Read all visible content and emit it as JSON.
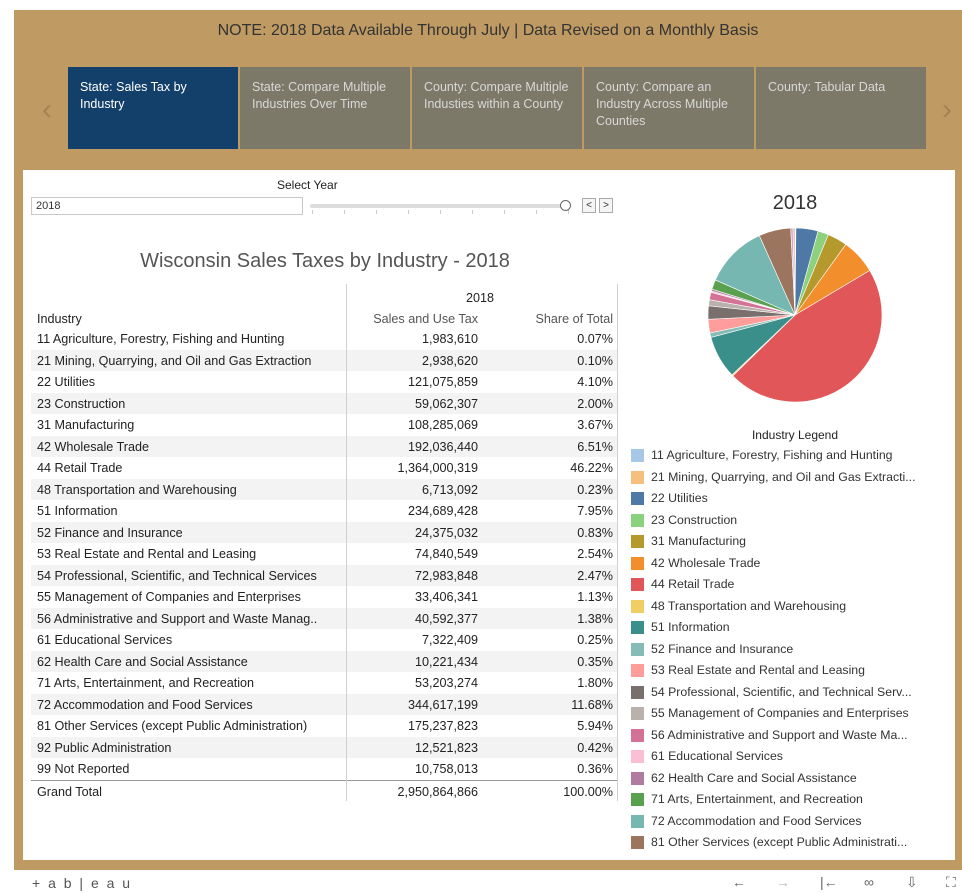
{
  "note": "NOTE: 2018 Data Available Through July | Data Revised on a Monthly Basis",
  "tabs": [
    {
      "label": "State: Sales Tax by Industry"
    },
    {
      "label": "State: Compare Multiple Industries Over Time"
    },
    {
      "label": "County: Compare Multiple Industies within a County"
    },
    {
      "label": "County: Compare an Industry Across Multiple Counties"
    },
    {
      "label": "County: Tabular Data"
    }
  ],
  "nav": {
    "prev_icon": "chevron-left-icon",
    "next_icon": "chevron-right-icon"
  },
  "year_filter": {
    "label": "Select Year",
    "value": "2018",
    "prev": "<",
    "next": ">"
  },
  "table": {
    "title": "Wisconsin Sales Taxes by Industry - 2018",
    "year_header": "2018",
    "col_industry": "Industry",
    "col_tax": "Sales and Use Tax",
    "col_share": "Share of Total",
    "rows": [
      {
        "industry": "11 Agriculture, Forestry, Fishing and Hunting",
        "tax": "1,983,610",
        "share": "0.07%"
      },
      {
        "industry": "21 Mining, Quarrying, and Oil and Gas Extraction",
        "tax": "2,938,620",
        "share": "0.10%"
      },
      {
        "industry": "22 Utilities",
        "tax": "121,075,859",
        "share": "4.10%"
      },
      {
        "industry": "23 Construction",
        "tax": "59,062,307",
        "share": "2.00%"
      },
      {
        "industry": "31 Manufacturing",
        "tax": "108,285,069",
        "share": "3.67%"
      },
      {
        "industry": "42 Wholesale Trade",
        "tax": "192,036,440",
        "share": "6.51%"
      },
      {
        "industry": "44 Retail Trade",
        "tax": "1,364,000,319",
        "share": "46.22%"
      },
      {
        "industry": "48 Transportation and Warehousing",
        "tax": "6,713,092",
        "share": "0.23%"
      },
      {
        "industry": "51 Information",
        "tax": "234,689,428",
        "share": "7.95%"
      },
      {
        "industry": "52 Finance and Insurance",
        "tax": "24,375,032",
        "share": "0.83%"
      },
      {
        "industry": "53 Real Estate and Rental and Leasing",
        "tax": "74,840,549",
        "share": "2.54%"
      },
      {
        "industry": "54 Professional, Scientific, and Technical Services",
        "tax": "72,983,848",
        "share": "2.47%"
      },
      {
        "industry": "55 Management of Companies and Enterprises",
        "tax": "33,406,341",
        "share": "1.13%"
      },
      {
        "industry": "56 Administrative and Support and Waste Manag..",
        "tax": "40,592,377",
        "share": "1.38%"
      },
      {
        "industry": "61 Educational Services",
        "tax": "7,322,409",
        "share": "0.25%"
      },
      {
        "industry": "62 Health Care and Social Assistance",
        "tax": "10,221,434",
        "share": "0.35%"
      },
      {
        "industry": "71 Arts, Entertainment, and Recreation",
        "tax": "53,203,274",
        "share": "1.80%"
      },
      {
        "industry": "72 Accommodation and Food Services",
        "tax": "344,617,199",
        "share": "11.68%"
      },
      {
        "industry": "81 Other Services (except Public Administration)",
        "tax": "175,237,823",
        "share": "5.94%"
      },
      {
        "industry": "92 Public Administration",
        "tax": "12,521,823",
        "share": "0.42%"
      },
      {
        "industry": "99 Not Reported",
        "tax": "10,758,013",
        "share": "0.36%"
      }
    ],
    "total": {
      "industry": "Grand Total",
      "tax": "2,950,864,866",
      "share": "100.00%"
    }
  },
  "chart_data": {
    "type": "pie",
    "title": "2018",
    "legend_title": "Industry Legend",
    "legend_placement": "bottom-right",
    "slices": [
      {
        "label": "11 Agriculture, Forestry, Fishing and Hunting",
        "value": 0.07,
        "color": "#a6c8e6"
      },
      {
        "label": "21 Mining, Quarrying, and Oil and Gas Extracti...",
        "value": 0.1,
        "color": "#f6bf7e"
      },
      {
        "label": "22 Utilities",
        "value": 4.1,
        "color": "#4e79a7"
      },
      {
        "label": "23 Construction",
        "value": 2.0,
        "color": "#8cd17d"
      },
      {
        "label": "31 Manufacturing",
        "value": 3.67,
        "color": "#b6992d"
      },
      {
        "label": "42 Wholesale Trade",
        "value": 6.51,
        "color": "#f28e2b"
      },
      {
        "label": "44 Retail Trade",
        "value": 46.22,
        "color": "#e15759"
      },
      {
        "label": "48 Transportation and Warehousing",
        "value": 0.23,
        "color": "#f1ce63"
      },
      {
        "label": "51 Information",
        "value": 7.95,
        "color": "#3b8f8a"
      },
      {
        "label": "52 Finance and Insurance",
        "value": 0.83,
        "color": "#86bcb6"
      },
      {
        "label": "53 Real Estate and Rental and Leasing",
        "value": 2.54,
        "color": "#ff9d9a"
      },
      {
        "label": "54 Professional, Scientific, and Technical Serv...",
        "value": 2.47,
        "color": "#79706e"
      },
      {
        "label": "55 Management of Companies and Enterprises",
        "value": 1.13,
        "color": "#bab0ac"
      },
      {
        "label": "56 Administrative and Support and Waste Ma...",
        "value": 1.38,
        "color": "#d37295"
      },
      {
        "label": "61 Educational Services",
        "value": 0.25,
        "color": "#fabfd2"
      },
      {
        "label": "62 Health Care and Social Assistance",
        "value": 0.35,
        "color": "#b07aa1"
      },
      {
        "label": "71 Arts, Entertainment, and Recreation",
        "value": 1.8,
        "color": "#59a14f"
      },
      {
        "label": "72 Accommodation and Food Services",
        "value": 11.68,
        "color": "#76b7b2"
      },
      {
        "label": "81 Other Services (except Public Administrati...",
        "value": 5.94,
        "color": "#9c755f"
      },
      {
        "label": "92 Public Administration",
        "value": 0.42,
        "color": "#d4a6c8",
        "legend": false
      },
      {
        "label": "99 Not Reported",
        "value": 0.36,
        "color": "#d7b5a6",
        "legend": false
      }
    ]
  },
  "footer": {
    "logo": "+ a b | e a u",
    "icons": [
      "undo-icon",
      "redo-icon",
      "revert-icon",
      "share-icon",
      "download-icon",
      "fullscreen-icon"
    ]
  }
}
